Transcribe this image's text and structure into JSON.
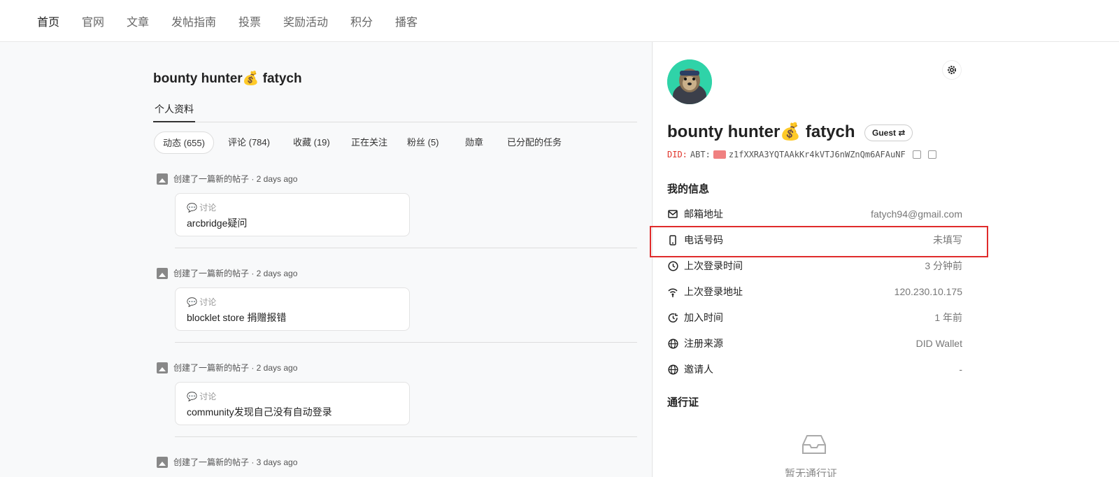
{
  "nav": {
    "items": [
      {
        "label": "首页",
        "active": true
      },
      {
        "label": "官网",
        "active": false
      },
      {
        "label": "文章",
        "active": false
      },
      {
        "label": "发帖指南",
        "active": false
      },
      {
        "label": "投票",
        "active": false
      },
      {
        "label": "奖励活动",
        "active": false
      },
      {
        "label": "积分",
        "active": false
      },
      {
        "label": "播客",
        "active": false
      }
    ]
  },
  "profile": {
    "name": "bounty hunter💰 fatych",
    "sub_tab": "个人资料",
    "chips": [
      {
        "label": "动态 (655)",
        "active": true
      },
      {
        "label": "评论 (784)",
        "active": false
      },
      {
        "label": "收藏 (19)",
        "active": false
      },
      {
        "label": "正在关注",
        "active": false
      },
      {
        "label": "粉丝 (5)",
        "active": false
      },
      {
        "label": "勋章",
        "active": false
      },
      {
        "label": "已分配的任务",
        "active": false
      }
    ]
  },
  "feed": [
    {
      "meta": "创建了一篇新的帖子 · 2 days ago",
      "category": "💬 讨论",
      "title": "arcbridge疑问"
    },
    {
      "meta": "创建了一篇新的帖子 · 2 days ago",
      "category": "💬 讨论",
      "title": "blocklet store 捐赠报错"
    },
    {
      "meta": "创建了一篇新的帖子 · 2 days ago",
      "category": "💬 讨论",
      "title": "community发现自己没有自动登录"
    },
    {
      "meta": "创建了一篇新的帖子 · 3 days ago",
      "category": "",
      "title": ""
    }
  ],
  "user_card": {
    "name": "bounty hunter💰 fatych",
    "badge": "Guest ⇄",
    "did_prefix": "DID:",
    "did_value": "ABT:",
    "did_address": "z1fXXRA3YQTAAkKr4kVTJ6nWZnQm6AFAuNF"
  },
  "my_info": {
    "title": "我的信息",
    "rows": [
      {
        "icon": "mail-icon",
        "label": "邮箱地址",
        "value": "fatych94@gmail.com"
      },
      {
        "icon": "phone-icon",
        "label": "电话号码",
        "value": "未填写"
      },
      {
        "icon": "clock-icon",
        "label": "上次登录时间",
        "value": "3 分钟前"
      },
      {
        "icon": "wifi-location-icon",
        "label": "上次登录地址",
        "value": "120.230.10.175"
      },
      {
        "icon": "history-icon",
        "label": "加入时间",
        "value": "1 年前"
      },
      {
        "icon": "globe-icon",
        "label": "注册来源",
        "value": "DID Wallet"
      },
      {
        "icon": "globe-icon",
        "label": "邀请人",
        "value": "-"
      }
    ]
  },
  "passport": {
    "title": "通行证",
    "empty_text": "暂无通行证"
  },
  "colors": {
    "highlight": "#e02b2b",
    "avatar_bg": "#2fd3a8",
    "did_prefix": "#e0352b"
  }
}
